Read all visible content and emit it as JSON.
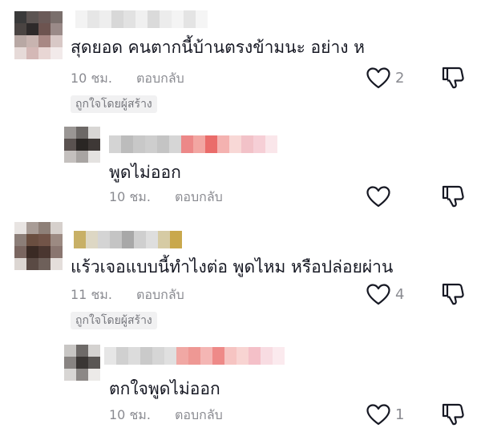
{
  "comments": [
    {
      "text": "สุดยอด คนตากนี้บ้านตรงข้ามนะ อย่าง ห",
      "time": "10 ชม.",
      "reply_label": "ตอบกลับ",
      "badge": "ถูกใจโดยผู้สร้าง",
      "likes": "2",
      "avatar_icon": "blurred-avatar-icon",
      "replies": [
        {
          "text": "พูดไม่ออก",
          "time": "10 ชม.",
          "reply_label": "ตอบกลับ",
          "likes": ""
        }
      ]
    },
    {
      "text": "แร้วเจอแบบนี้ทำไงต่อ พูดไหม หรือปล่อยผ่าน",
      "time": "11 ชม.",
      "reply_label": "ตอบกลับ",
      "badge": "ถูกใจโดยผู้สร้าง",
      "likes": "4",
      "avatar_icon": "blurred-avatar-icon",
      "replies": [
        {
          "text": "ตกใจพูดไม่ออก",
          "time": "10 ชม.",
          "reply_label": "ตอบกลับ",
          "likes": "1"
        }
      ]
    }
  ],
  "colors": {
    "text": "#161823",
    "muted": "#8a8b91",
    "badge_bg": "#f1f1f2",
    "icon": "#161823"
  },
  "icons": [
    "heart-icon",
    "thumbs-down-icon"
  ]
}
